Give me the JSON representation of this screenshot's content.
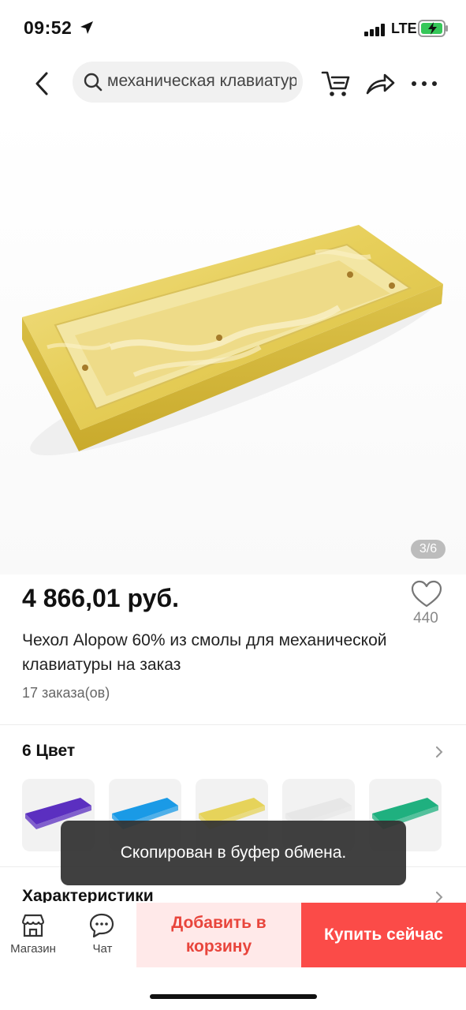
{
  "status": {
    "time": "09:52",
    "network": "LTE"
  },
  "nav": {
    "search_text": "механическая клавиатура"
  },
  "gallery": {
    "page_indicator": "3/6"
  },
  "product": {
    "price": "4 866,01 руб.",
    "wishlist_count": "440",
    "title": "Чехол Alopow 60% из смолы для механической клавиатуры на заказ",
    "orders": "17 заказа(ов)"
  },
  "colors": {
    "header": "6 Цвет",
    "swatches": [
      "#5b2fc0",
      "#1a9ae6",
      "#e6d35a",
      "#e7e7e7",
      "#1fb07f"
    ]
  },
  "specs": {
    "header": "Характеристики"
  },
  "toast": {
    "text": "Скопирован в буфер обмена."
  },
  "bottom": {
    "store_label": "Магазин",
    "chat_label": "Чат",
    "add_to_cart": "Добавить в корзину",
    "buy_now": "Купить сейчас"
  },
  "theme": {
    "accent": "#fb4b48",
    "accent_light": "#ffe9e9"
  }
}
